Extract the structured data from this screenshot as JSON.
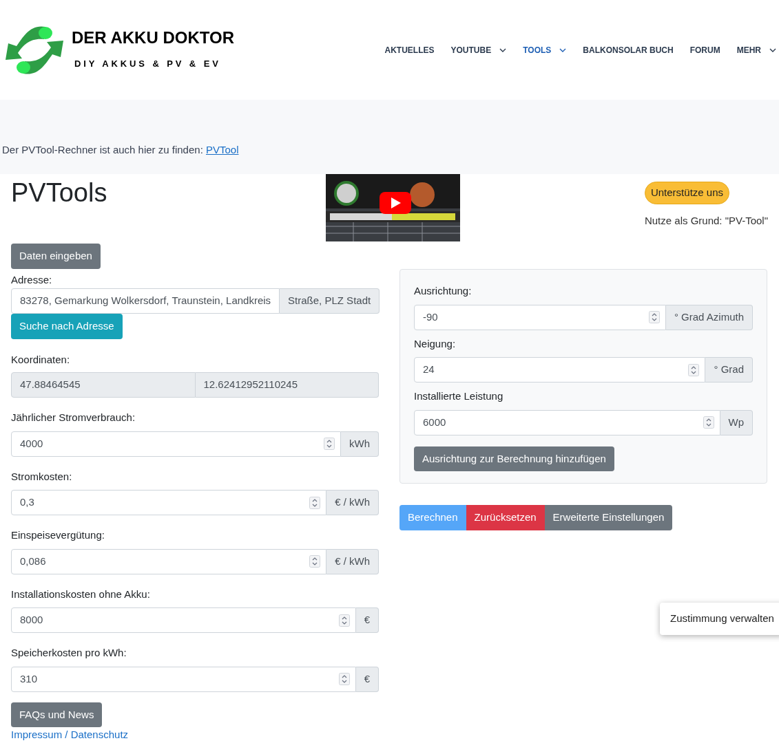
{
  "logo": {
    "title": "DER AKKU DOKTOR",
    "tagline": "DIY AKKUS & PV & EV"
  },
  "nav": [
    {
      "label": "AKTUELLES",
      "selected": false,
      "has_menu": false
    },
    {
      "label": "YOUTUBE",
      "selected": false,
      "has_menu": true
    },
    {
      "label": "TOOLS",
      "selected": true,
      "has_menu": true
    },
    {
      "label": "BALKONSOLAR BUCH",
      "selected": false,
      "has_menu": false
    },
    {
      "label": "FORUM",
      "selected": false,
      "has_menu": false
    },
    {
      "label": "MEHR",
      "selected": false,
      "has_menu": true
    }
  ],
  "notice": {
    "text": "Der PVTool-Rechner ist auch hier zu finden: ",
    "link": "PVTool"
  },
  "title": "PVTools",
  "support": {
    "button": "Unterstütze uns",
    "note": "Nutze als Grund: \"PV-Tool\""
  },
  "data_button": "Daten eingeben",
  "address": {
    "label": "Adresse:",
    "value": "83278, Gemarkung Wolkersdorf, Traunstein, Landkreis",
    "addon": "Straße, PLZ Stadt",
    "button": "Suche nach Adresse"
  },
  "coordinates": {
    "label": "Koordinaten:",
    "values": [
      "47.88464545",
      "12.62412952110245"
    ],
    "disabled": true
  },
  "fields": [
    {
      "label": "Jährlicher Stromverbrauch:",
      "value": "4000",
      "unit": "kWh"
    },
    {
      "label": "Stromkosten:",
      "value": "0,3",
      "unit": "€ / kWh"
    },
    {
      "label": "Einspeisevergütung:",
      "value": "0,086",
      "unit": "€ / kWh"
    },
    {
      "label": "Installationskosten ohne Akku:",
      "value": "8000",
      "unit": "€"
    },
    {
      "label": "Speicherkosten pro kWh:",
      "value": "310",
      "unit": "€"
    }
  ],
  "faq_button": "FAQs und News",
  "footer_link": "Impressum / Datenschutz",
  "orientation": {
    "fields": [
      {
        "label": "Ausrichtung:",
        "value": "-90",
        "unit": "° Grad Azimuth"
      },
      {
        "label": "Neigung:",
        "value": "24",
        "unit": "° Grad"
      },
      {
        "label": "Installierte Leistung",
        "value": "6000",
        "unit": "Wp"
      }
    ],
    "button": "Ausrichtung zur Berechnung hinzufügen"
  },
  "actions": [
    {
      "label": "Berechnen",
      "kind": "primary"
    },
    {
      "label": "Zurücksetzen",
      "kind": "danger"
    },
    {
      "label": "Erweiterte Einstellungen",
      "kind": "secondary"
    }
  ],
  "consent": "Zustimmung verwalten"
}
